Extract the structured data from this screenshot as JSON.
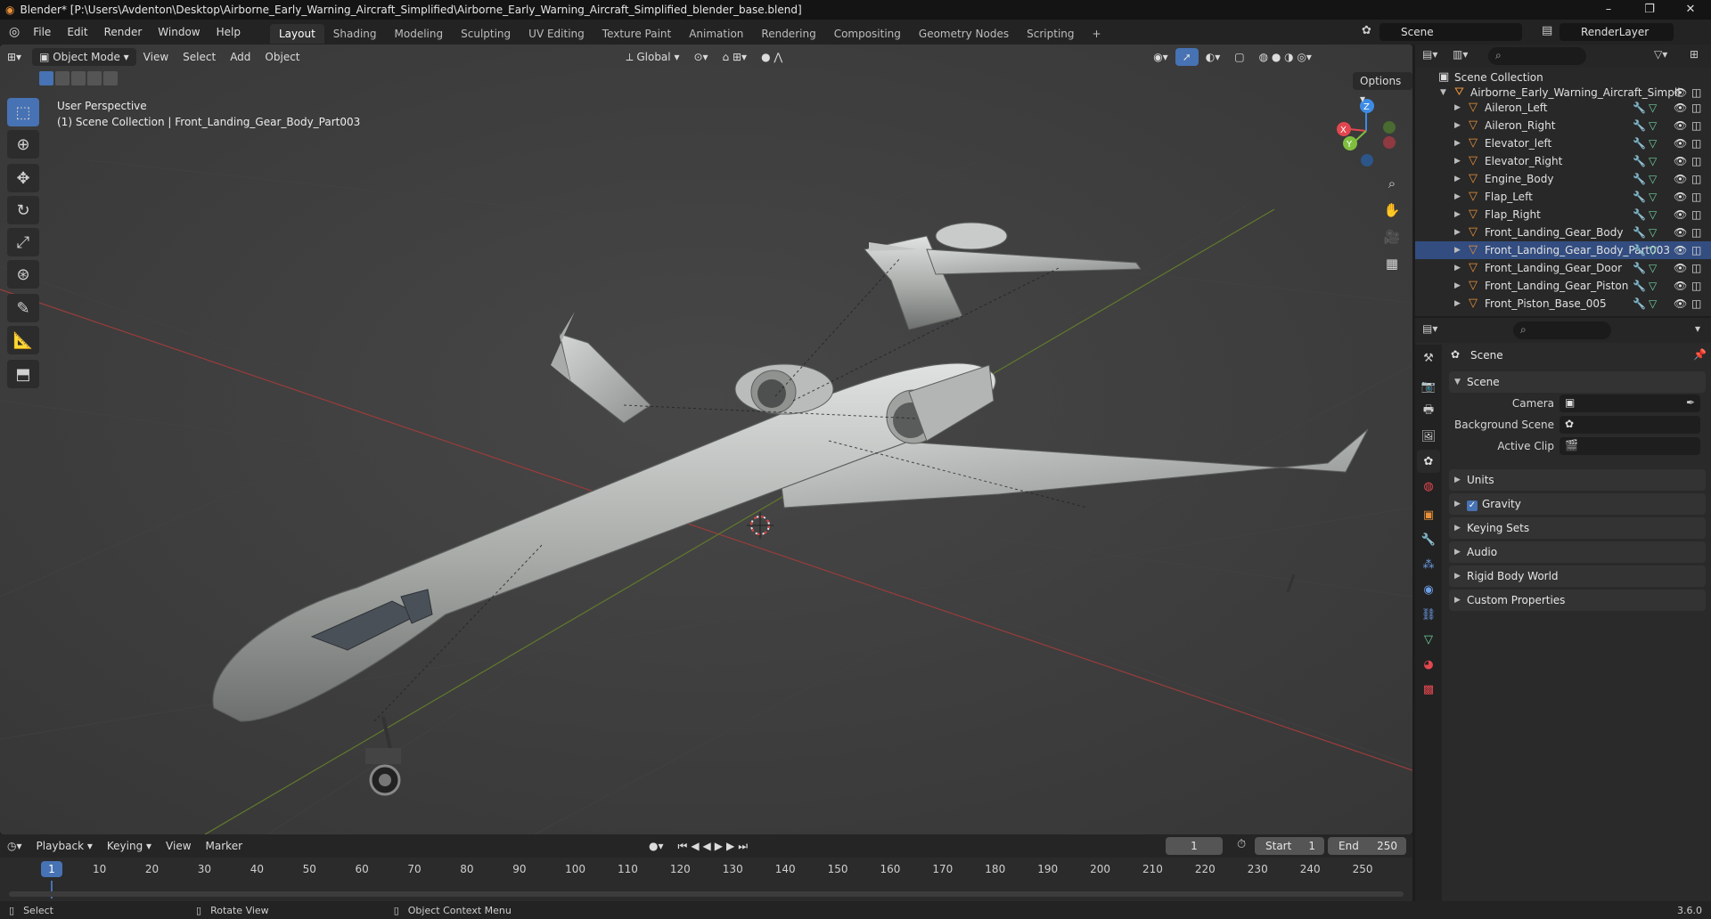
{
  "window": {
    "title": "Blender* [P:\\Users\\Avdenton\\Desktop\\Airborne_Early_Warning_Aircraft_Simplified\\Airborne_Early_Warning_Aircraft_Simplified_blender_base.blend]",
    "minimize": "–",
    "maximize": "❐",
    "close": "✕"
  },
  "menu": [
    "File",
    "Edit",
    "Render",
    "Window",
    "Help"
  ],
  "workspaces": [
    "Layout",
    "Shading",
    "Modeling",
    "Sculpting",
    "UV Editing",
    "Texture Paint",
    "Animation",
    "Rendering",
    "Compositing",
    "Geometry Nodes",
    "Scripting"
  ],
  "active_workspace": "Layout",
  "add_workspace": "+",
  "scene_name": "Scene",
  "view_layer": "RenderLayer",
  "viewport": {
    "mode": "Object Mode",
    "menus": [
      "View",
      "Select",
      "Add",
      "Object"
    ],
    "transform_orientation": "Global",
    "options_label": "Options",
    "info_line1": "User Perspective",
    "info_line2": "(1) Scene Collection | Front_Landing_Gear_Body_Part003",
    "gizmo_axes": {
      "x": "X",
      "y": "Y",
      "z": "Z"
    }
  },
  "timeline": {
    "menus": [
      "Playback",
      "Keying",
      "View",
      "Marker"
    ],
    "current_frame": "1",
    "start_label": "Start",
    "start": "1",
    "end_label": "End",
    "end": "250",
    "ticks": [
      "10",
      "20",
      "30",
      "40",
      "50",
      "60",
      "70",
      "80",
      "90",
      "100",
      "110",
      "120",
      "130",
      "140",
      "150",
      "160",
      "170",
      "180",
      "190",
      "200",
      "210",
      "220",
      "230",
      "240",
      "250"
    ],
    "frame_indicator": "1"
  },
  "statusbar": {
    "select": "Select",
    "rotate": "Rotate View",
    "context": "Object Context Menu",
    "version": "3.6.0"
  },
  "outliner": {
    "root": "Scene Collection",
    "collection": "Airborne_Early_Warning_Aircraft_Simpli",
    "items": [
      {
        "name": "Aileron_Left"
      },
      {
        "name": "Aileron_Right"
      },
      {
        "name": "Elevator_left"
      },
      {
        "name": "Elevator_Right"
      },
      {
        "name": "Engine_Body"
      },
      {
        "name": "Flap_Left"
      },
      {
        "name": "Flap_Right"
      },
      {
        "name": "Front_Landing_Gear_Body"
      },
      {
        "name": "Front_Landing_Gear_Body_Part003"
      },
      {
        "name": "Front_Landing_Gear_Door"
      },
      {
        "name": "Front_Landing_Gear_Piston"
      },
      {
        "name": "Front_Piston_Base_005"
      }
    ]
  },
  "properties": {
    "context_title": "Scene",
    "panel_scene": "Scene",
    "camera_label": "Camera",
    "background_scene_label": "Background Scene",
    "active_clip_label": "Active Clip",
    "panels": [
      "Units",
      "Gravity",
      "Keying Sets",
      "Audio",
      "Rigid Body World",
      "Custom Properties"
    ]
  },
  "colors": {
    "accent": "#4772b3",
    "object_orange": "#e9913a",
    "axis_x": "#e2474f",
    "axis_y": "#7fbf3f",
    "axis_z": "#3d8be5"
  }
}
